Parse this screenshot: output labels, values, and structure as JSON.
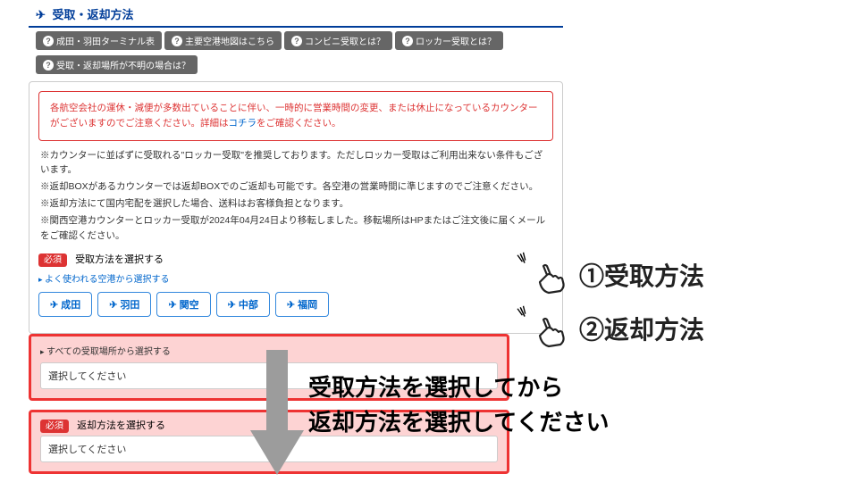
{
  "section": {
    "title": "受取・返却方法"
  },
  "help": [
    "成田・羽田ターミナル表",
    "主要空港地図はこちら",
    "コンビニ受取とは？",
    "ロッカー受取とは？",
    "受取・返却場所が不明の場合は？"
  ],
  "alert": {
    "line1": "各航空会社の運休・減便が多数出ていることに伴い、一時的に営業時間の変更、または休止になっているカウンターがございますのでご注意ください。詳細は",
    "link": "コチラ",
    "line2": "をご確認ください。"
  },
  "notes": [
    "※カウンターに並ばずに受取れる\"ロッカー受取\"を推奨しております。ただしロッカー受取はご利用出来ない条件もございます。",
    "※返却BOXがあるカウンターでは返却BOXでのご返却も可能です。各空港の営業時間に準じますのでご注意ください。",
    "※返却方法にて国内宅配を選択した場合、送料はお客様負担となります。",
    "※関西空港カウンターとロッカー受取が2024年04月24日より移転しました。移転場所はHPまたはご注文後に届くメールをご確認ください。"
  ],
  "pickup": {
    "required": "必須",
    "label": "受取方法を選択する",
    "sublabel": "よく使われる空港から選択する",
    "airports": [
      "成田",
      "羽田",
      "関空",
      "中部",
      "福岡"
    ],
    "allLabel": "すべての受取場所から選択する",
    "placeholder": "選択してください"
  },
  "returnSel": {
    "required": "必須",
    "label": "返却方法を選択する",
    "placeholder": "選択してください"
  },
  "callouts": {
    "first": "①受取方法",
    "second": "②返却方法"
  },
  "instruction": {
    "line1": "受取方法を選択してから",
    "line2": "返却方法を選択してください"
  }
}
